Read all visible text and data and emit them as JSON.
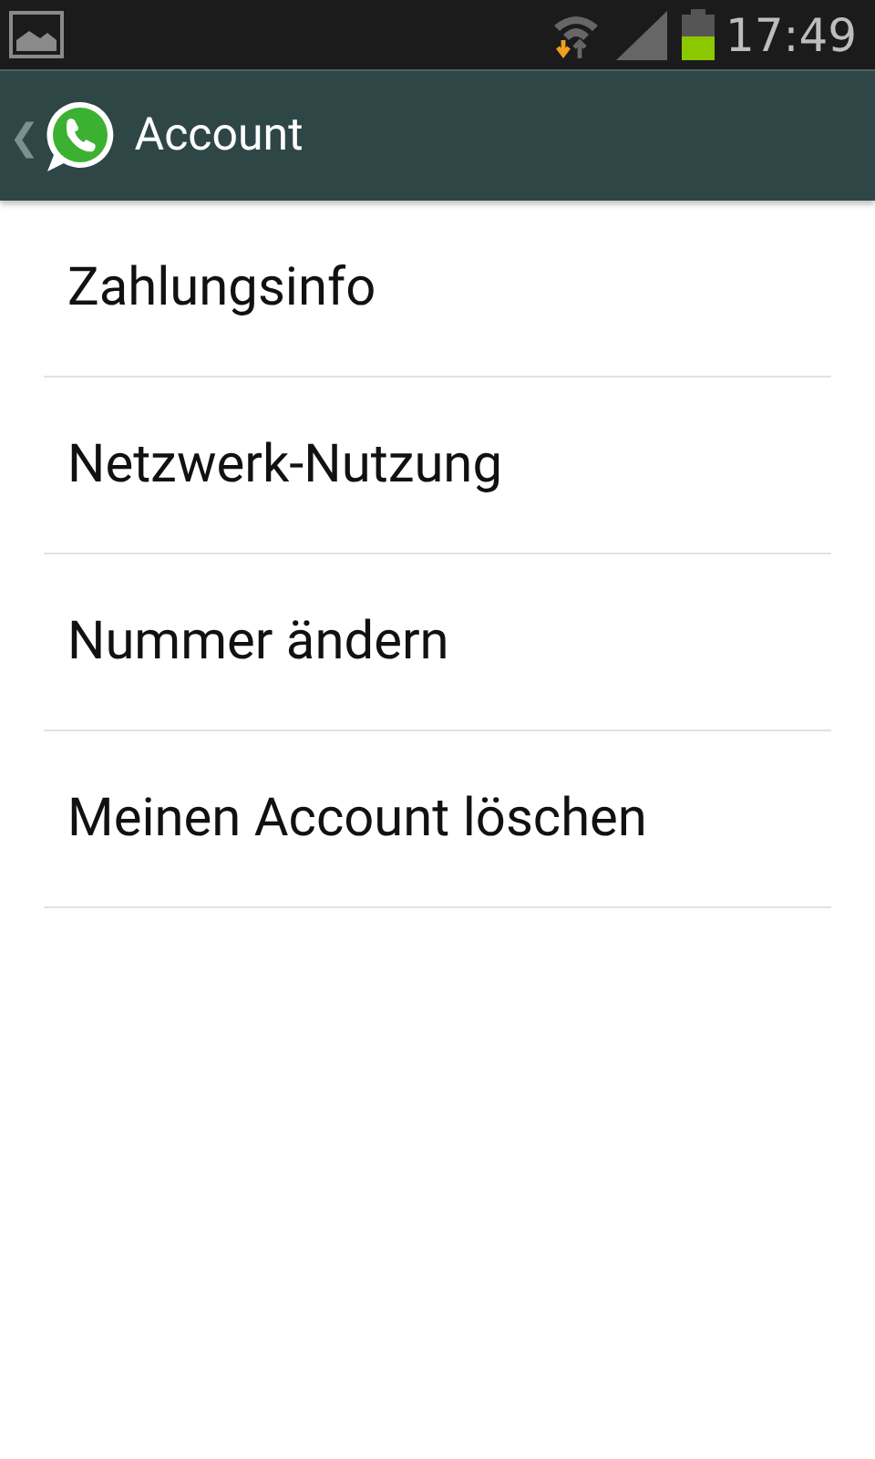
{
  "status_bar": {
    "time": "17:49"
  },
  "app_bar": {
    "back": "❮",
    "title": "Account"
  },
  "settings": [
    {
      "label": "Zahlungsinfo"
    },
    {
      "label": "Netzwerk-Nutzung"
    },
    {
      "label": "Nummer ändern"
    },
    {
      "label": "Meinen Account löschen"
    }
  ]
}
